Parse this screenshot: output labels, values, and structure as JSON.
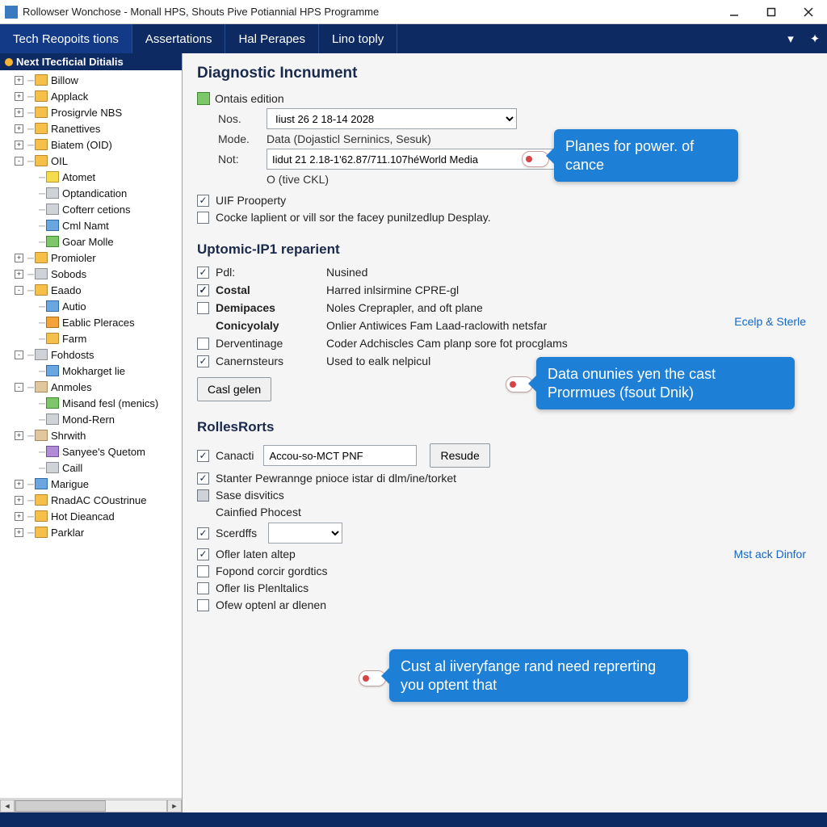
{
  "window": {
    "title": "Rollowser Wonchose - Monall HPS, Shouts Pive Potiannial HPS Programme"
  },
  "ribbon": {
    "tabs": [
      "Tech Reopoits tions",
      "Assertations",
      "Hal Perapes",
      "Lino toply"
    ],
    "active_index": 0
  },
  "tree": {
    "header": "Next ITecficial Ditialis",
    "items": [
      {
        "t": "+",
        "d": 1,
        "ico": "folder",
        "label": "Billow"
      },
      {
        "t": "+",
        "d": 1,
        "ico": "folder",
        "label": "Applack"
      },
      {
        "t": "+",
        "d": 1,
        "ico": "folder",
        "label": "Prosigrvle NBS"
      },
      {
        "t": "+",
        "d": 1,
        "ico": "folder",
        "label": "Ranettives"
      },
      {
        "t": "+",
        "d": 1,
        "ico": "folder",
        "label": "Biatem (OID)"
      },
      {
        "t": "-",
        "d": 1,
        "ico": "folder",
        "label": "OIL"
      },
      {
        "t": "",
        "d": 2,
        "ico": "ico-yellow",
        "label": "Atomet"
      },
      {
        "t": "",
        "d": 2,
        "ico": "ico-grey",
        "label": "Optandication"
      },
      {
        "t": "",
        "d": 2,
        "ico": "ico-grey",
        "label": "Cofterr cetions"
      },
      {
        "t": "",
        "d": 2,
        "ico": "ico-blue",
        "label": "Cml Namt"
      },
      {
        "t": "",
        "d": 2,
        "ico": "ico-green",
        "label": "Goar Molle"
      },
      {
        "t": "+",
        "d": 1,
        "ico": "folder",
        "label": "Promioler"
      },
      {
        "t": "+",
        "d": 1,
        "ico": "ico-grey",
        "label": "Sobods"
      },
      {
        "t": "-",
        "d": 1,
        "ico": "folder",
        "label": "Eaado"
      },
      {
        "t": "",
        "d": 2,
        "ico": "ico-blue",
        "label": "Autio"
      },
      {
        "t": "",
        "d": 2,
        "ico": "ico-orange",
        "label": "Eablic Pleraces"
      },
      {
        "t": "",
        "d": 2,
        "ico": "folder",
        "label": "Farm"
      },
      {
        "t": "-",
        "d": 1,
        "ico": "ico-grey",
        "label": "Fohdosts"
      },
      {
        "t": "",
        "d": 2,
        "ico": "ico-blue",
        "label": "Mokharget lie"
      },
      {
        "t": "-",
        "d": 1,
        "ico": "ico-tan",
        "label": "Anmoles"
      },
      {
        "t": "",
        "d": 2,
        "ico": "ico-green",
        "label": "Misand fesl (menics)"
      },
      {
        "t": "",
        "d": 2,
        "ico": "ico-grey",
        "label": "Mond-Rern"
      },
      {
        "t": "+",
        "d": 1,
        "ico": "ico-tan",
        "label": "Shrwith"
      },
      {
        "t": "",
        "d": 2,
        "ico": "ico-purple",
        "label": "Sanyee's Quetom"
      },
      {
        "t": "",
        "d": 2,
        "ico": "ico-grey",
        "label": "Caill"
      },
      {
        "t": "+",
        "d": 1,
        "ico": "ico-blue",
        "label": "Marigue"
      },
      {
        "t": "+",
        "d": 1,
        "ico": "folder",
        "label": "RnadAC COustrinue"
      },
      {
        "t": "+",
        "d": 1,
        "ico": "folder",
        "label": "Hot Dieancad"
      },
      {
        "t": "+",
        "d": 1,
        "ico": "folder",
        "label": "Parklar"
      }
    ]
  },
  "section1": {
    "title": "Diagnostic Incnument",
    "edition_label": "Ontais edition",
    "rows": {
      "nos_label": "Nos.",
      "nos_value": "Iiust 26 2 18-14 2028",
      "mode_label": "Mode.",
      "mode_value": "Data (Dojasticl Serninics, Sesuk)",
      "not_label": "Not:",
      "not_value": "Iidut 21 2.18-1'62.87/711.107héWorld Media",
      "sub_note": "O (tive CKL)"
    },
    "chk1": "UIF Prooperty",
    "chk2": "Cocke laplient or vill sor the facey punilzedlup Desplay."
  },
  "section2": {
    "title": "Uptomic-IP1 reparient",
    "link": "Ecelp & Sterle",
    "options": [
      {
        "on": true,
        "bold": false,
        "name": "Pdl:",
        "desc": "Nusined"
      },
      {
        "on": true,
        "bold": true,
        "name": "Costal",
        "desc": "Harred inlsirmine CPRE-gl"
      },
      {
        "on": false,
        "bold": true,
        "name": "Demipaces",
        "desc": "Noles Creprapler, and oft plane"
      },
      {
        "on": null,
        "bold": true,
        "name": "Conicyolaly",
        "desc": "Onlier Antiwices Fam Laad-raclowith netsfar"
      },
      {
        "on": false,
        "bold": false,
        "name": "Derventinage",
        "desc": "Coder Adchiscles Cam planp sore fot procglams"
      },
      {
        "on": true,
        "bold": false,
        "name": "Canernsteurs",
        "desc": "Used to ealk nelpicul"
      }
    ],
    "button": "Casl gelen"
  },
  "section3": {
    "title": "RollesRorts",
    "link": "Mst ack Dinfor",
    "row1_label": "Canacti",
    "row1_value": "Accou-so-MCT PNF",
    "row1_button": "Resude",
    "rows": [
      {
        "on": true,
        "label": "Stanter Pewrannge pnioce istar di dlm/ine/torket"
      },
      {
        "on": "ind",
        "label": "Sase disvitics"
      },
      {
        "on": null,
        "label": "Cainfied Phocest"
      },
      {
        "on": true,
        "label": "Scerdffs"
      },
      {
        "on": true,
        "label": "Ofler laten altep"
      },
      {
        "on": false,
        "label": "Fopond corcir gordtics"
      },
      {
        "on": false,
        "label": "Ofler Iis Plenltalics"
      },
      {
        "on": false,
        "label": "Ofew optenl ar dlenen"
      }
    ]
  },
  "callouts": {
    "c1": "Planes for power. of cance",
    "c2": "Data onunies yen the cast Prorrmues (fsout Dnik)",
    "c3": "Cust al iiveryfange rand need reprerting you optent that"
  }
}
